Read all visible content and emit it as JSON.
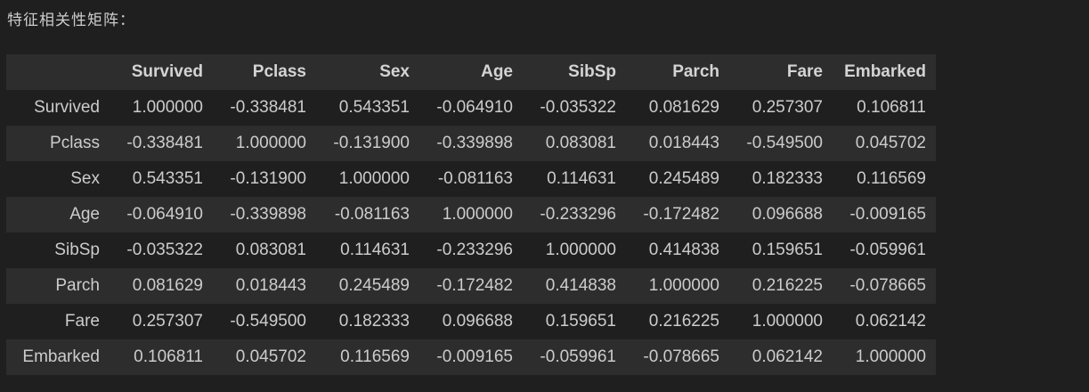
{
  "output": {
    "label": "特征相关性矩阵："
  },
  "table": {
    "columns": [
      "Survived",
      "Pclass",
      "Sex",
      "Age",
      "SibSp",
      "Parch",
      "Fare",
      "Embarked"
    ],
    "rows": [
      {
        "index": "Survived",
        "values": [
          "1.000000",
          "-0.338481",
          "0.543351",
          "-0.064910",
          "-0.035322",
          "0.081629",
          "0.257307",
          "0.106811"
        ]
      },
      {
        "index": "Pclass",
        "values": [
          "-0.338481",
          "1.000000",
          "-0.131900",
          "-0.339898",
          "0.083081",
          "0.018443",
          "-0.549500",
          "0.045702"
        ]
      },
      {
        "index": "Sex",
        "values": [
          "0.543351",
          "-0.131900",
          "1.000000",
          "-0.081163",
          "0.114631",
          "0.245489",
          "0.182333",
          "0.116569"
        ]
      },
      {
        "index": "Age",
        "values": [
          "-0.064910",
          "-0.339898",
          "-0.081163",
          "1.000000",
          "-0.233296",
          "-0.172482",
          "0.096688",
          "-0.009165"
        ]
      },
      {
        "index": "SibSp",
        "values": [
          "-0.035322",
          "0.083081",
          "0.114631",
          "-0.233296",
          "1.000000",
          "0.414838",
          "0.159651",
          "-0.059961"
        ]
      },
      {
        "index": "Parch",
        "values": [
          "0.081629",
          "0.018443",
          "0.245489",
          "-0.172482",
          "0.414838",
          "1.000000",
          "0.216225",
          "-0.078665"
        ]
      },
      {
        "index": "Fare",
        "values": [
          "0.257307",
          "-0.549500",
          "0.182333",
          "0.096688",
          "0.159651",
          "0.216225",
          "1.000000",
          "0.062142"
        ]
      },
      {
        "index": "Embarked",
        "values": [
          "0.106811",
          "0.045702",
          "0.116569",
          "-0.009165",
          "-0.059961",
          "-0.078665",
          "0.062142",
          "1.000000"
        ]
      }
    ]
  }
}
